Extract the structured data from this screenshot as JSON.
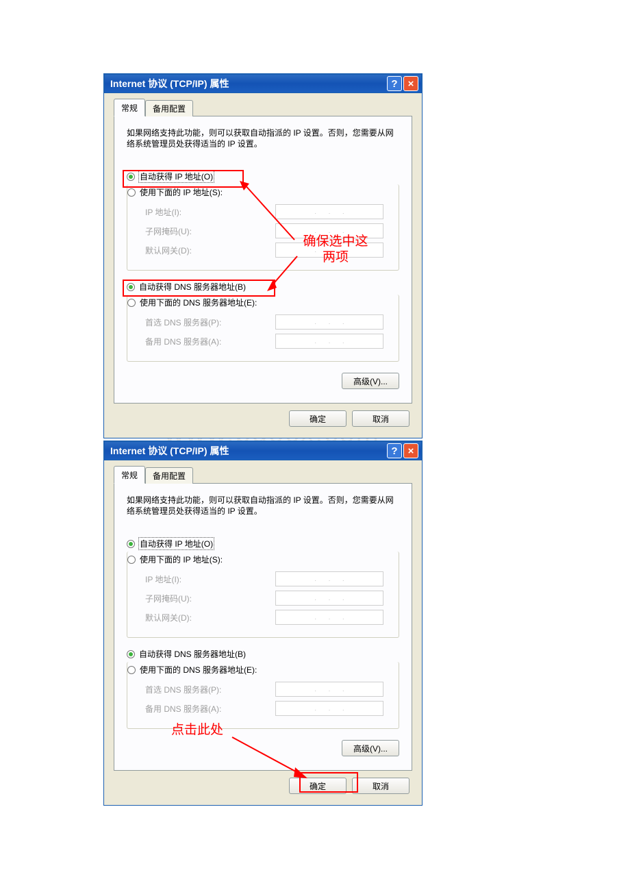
{
  "watermark": "www.bdocx.com",
  "dialog1": {
    "title": "Internet 协议 (TCP/IP) 属性",
    "tabs": {
      "general": "常规",
      "alternate": "备用配置"
    },
    "info": "如果网络支持此功能，则可以获取自动指派的 IP 设置。否则，您需要从网络系统管理员处获得适当的 IP 设置。",
    "ip": {
      "autoLabel": "自动获得 IP 地址(O)",
      "manualLabel": "使用下面的 IP 地址(S):",
      "ipaddr": "IP 地址(I):",
      "subnet": "子网掩码(U):",
      "gateway": "默认网关(D):"
    },
    "dns": {
      "autoLabel": "自动获得 DNS 服务器地址(B)",
      "manualLabel": "使用下面的 DNS 服务器地址(E):",
      "preferred": "首选 DNS 服务器(P):",
      "alternate": "备用 DNS 服务器(A):"
    },
    "advanced": "高级(V)...",
    "ok": "确定",
    "cancel": "取消",
    "annotation": "确保选中这\n两项"
  },
  "dialog2": {
    "title": "Internet 协议 (TCP/IP) 属性",
    "tabs": {
      "general": "常规",
      "alternate": "备用配置"
    },
    "info": "如果网络支持此功能，则可以获取自动指派的 IP 设置。否则，您需要从网络系统管理员处获得适当的 IP 设置。",
    "ip": {
      "autoLabel": "自动获得 IP 地址(O)",
      "manualLabel": "使用下面的 IP 地址(S):",
      "ipaddr": "IP 地址(I):",
      "subnet": "子网掩码(U):",
      "gateway": "默认网关(D):"
    },
    "dns": {
      "autoLabel": "自动获得 DNS 服务器地址(B)",
      "manualLabel": "使用下面的 DNS 服务器地址(E):",
      "preferred": "首选 DNS 服务器(P):",
      "alternate": "备用 DNS 服务器(A):"
    },
    "advanced": "高级(V)...",
    "ok": "确定",
    "cancel": "取消",
    "annotation": "点击此处"
  }
}
